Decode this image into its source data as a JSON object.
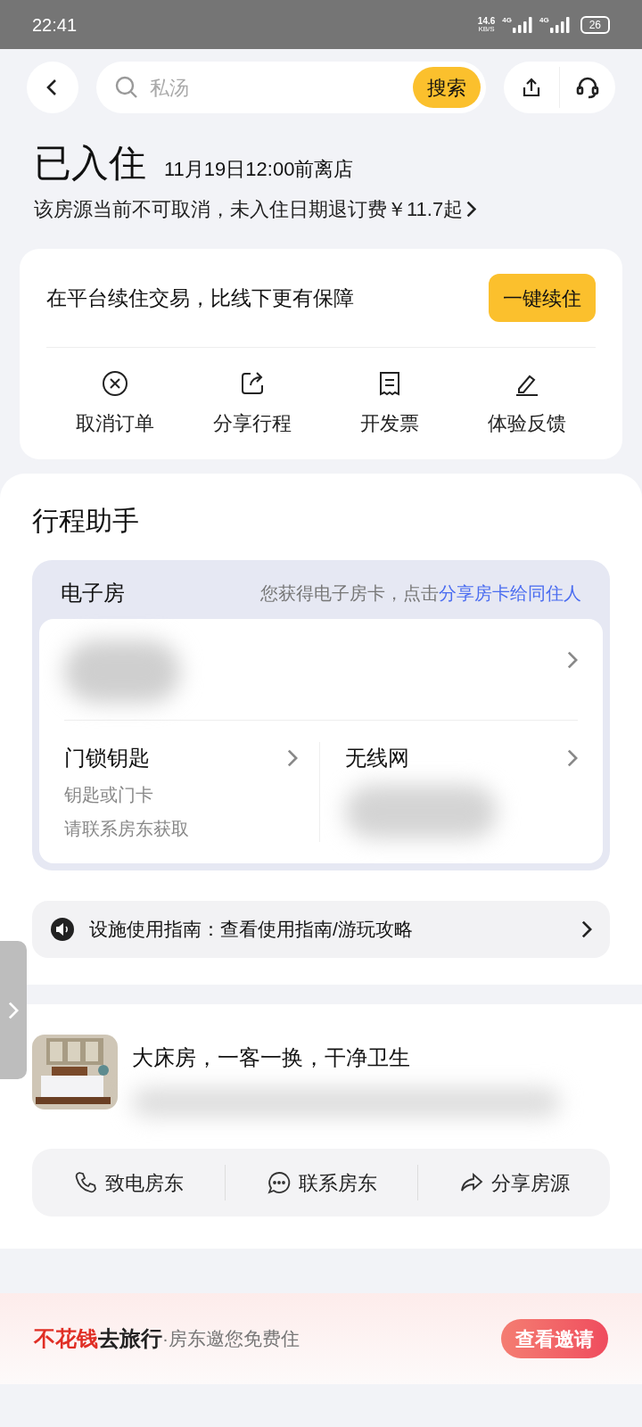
{
  "status_bar": {
    "time": "22:41",
    "speed_value": "14.6",
    "speed_unit": "KB/S",
    "signals": [
      "4G",
      "4G"
    ],
    "battery": "26"
  },
  "nav": {
    "search": {
      "placeholder": "私汤"
    },
    "search_button": "搜索"
  },
  "order_status": {
    "title": "已入住",
    "checkout": "11月19日12:00前离店",
    "policy": "该房源当前不可取消，未入住日期退订费￥11.7起"
  },
  "extend_card": {
    "text": "在平台续住交易，比线下更有保障",
    "button": "一键续住",
    "actions": [
      {
        "kind": "cancel",
        "label": "取消订单"
      },
      {
        "kind": "share",
        "label": "分享行程"
      },
      {
        "kind": "invoice",
        "label": "开发票"
      },
      {
        "kind": "feedback",
        "label": "体验反馈"
      }
    ]
  },
  "assistant": {
    "heading": "行程助手",
    "room_card": {
      "title": "电子房",
      "hint": "您获得电子房卡，点击",
      "link": "分享房卡给同住人"
    },
    "door": {
      "title": "门锁钥匙",
      "line1": "钥匙或门卡",
      "line2": "请联系房东获取"
    },
    "wifi": {
      "title": "无线网"
    },
    "guide": "设施使用指南：查看使用指南/游玩攻略"
  },
  "listing": {
    "title": "大床房，一客一换，干净卫生",
    "contacts": [
      {
        "kind": "phone",
        "label": "致电房东"
      },
      {
        "kind": "chat",
        "label": "联系房东"
      },
      {
        "kind": "share",
        "label": "分享房源"
      }
    ]
  },
  "promo": {
    "highlight": "不花钱",
    "title": "去旅行",
    "subtitle": "·房东邀您免费住",
    "button": "查看邀请"
  }
}
